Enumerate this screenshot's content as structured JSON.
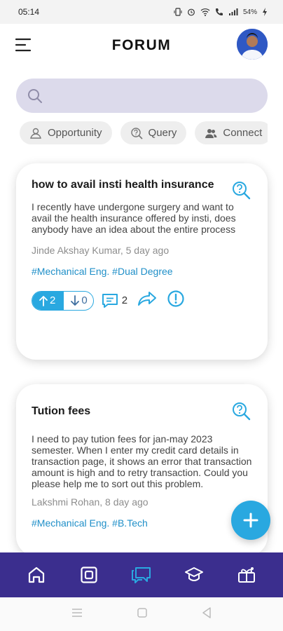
{
  "status_bar": {
    "time": "05:14",
    "battery": "54%"
  },
  "app_bar": {
    "title": "FORUM"
  },
  "search": {
    "placeholder": "",
    "value": ""
  },
  "chips": [
    {
      "label": "Opportunity",
      "icon": "opportunity-icon"
    },
    {
      "label": "Query",
      "icon": "query-icon"
    },
    {
      "label": "Connect",
      "icon": "people-icon"
    }
  ],
  "posts": [
    {
      "title": "how to avail insti health insurance",
      "body": "I recently have undergone surgery and want to avail the health insurance offered by insti, does anybody have an idea about the entire process",
      "meta": "Jinde Akshay Kumar, 5 day ago",
      "tags": "#Mechanical Eng. #Dual Degree",
      "upvotes": "2",
      "downvotes": "0",
      "comments": "2"
    },
    {
      "title": "Tution fees",
      "body": "I need to pay tution fees for jan-may 2023 semester. When I enter my credit card details in transaction page, it shows an error that transaction amount is high and to retry transaction. Could you please help me to sort out this problem.",
      "meta": "Lakshmi Rohan, 8 day ago",
      "tags": "#Mechanical Eng. #B.Tech"
    }
  ],
  "colors": {
    "accent": "#29a8e0",
    "nav_bg": "#3b2e8e",
    "search_bg": "#dcdaeb",
    "tag": "#1f8fc8"
  },
  "bottom_nav": [
    "home-icon",
    "explore-icon",
    "forum-icon",
    "academics-icon",
    "gifts-icon"
  ]
}
